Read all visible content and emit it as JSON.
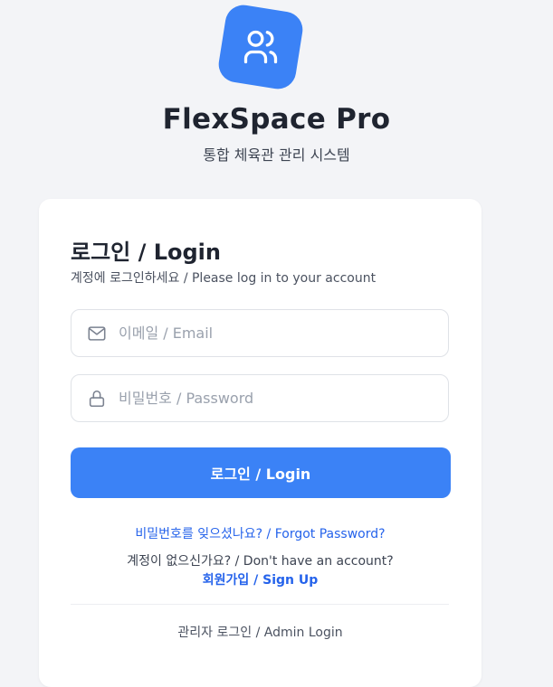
{
  "app": {
    "title": "FlexSpace Pro",
    "subtitle": "통합 체육관 관리 시스템",
    "logo_icon": "users-icon",
    "accent_color": "#3b82f6"
  },
  "login_card": {
    "title": "로그인 / Login",
    "subtitle": "계정에 로그인하세요 / Please log in to your account",
    "email": {
      "placeholder": "이메일 / Email",
      "value": "",
      "icon": "mail-icon"
    },
    "password": {
      "placeholder": "비밀번호 / Password",
      "value": "",
      "icon": "lock-icon"
    },
    "login_button": "로그인 / Login",
    "forgot_password": "비밀번호를 잊으셨나요? / Forgot Password?",
    "no_account": "계정이 없으신가요? / Don't have an account?",
    "sign_up": "회원가입 / Sign Up",
    "admin_login": "관리자 로그인 / Admin Login"
  }
}
